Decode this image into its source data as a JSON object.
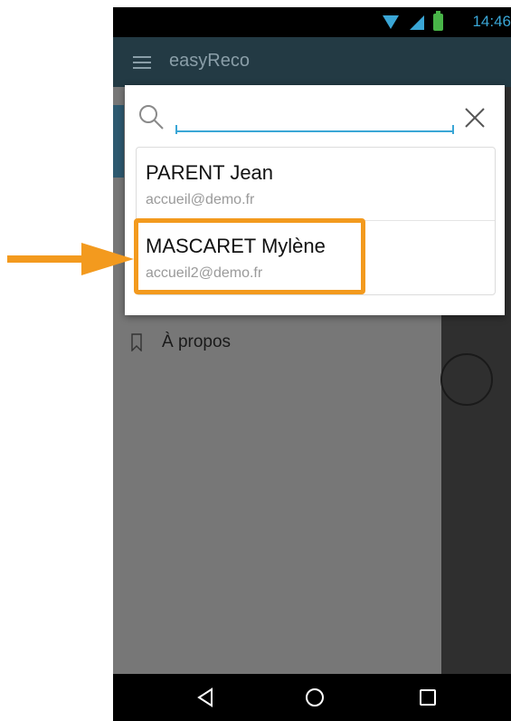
{
  "status_bar": {
    "time": "14:46",
    "wifi_icon": "wifi-icon",
    "signal_icon": "signal-icon",
    "battery_icon": "battery-charging-icon"
  },
  "app_bar": {
    "title": "easyReco",
    "menu_icon": "hamburger-icon"
  },
  "drawer": {
    "items": [
      {
        "label": "À propos",
        "icon": "bookmark-icon"
      }
    ]
  },
  "dialog": {
    "search": {
      "value": "",
      "placeholder": ""
    },
    "results": [
      {
        "name": "PARENT Jean",
        "email": "accueil@demo.fr"
      },
      {
        "name": "MASCARET Mylène",
        "email": "accueil2@demo.fr"
      }
    ]
  },
  "colors": {
    "accent": "#3aa6d6",
    "app_bar": "#233a44",
    "highlight": "#f39a1e"
  }
}
